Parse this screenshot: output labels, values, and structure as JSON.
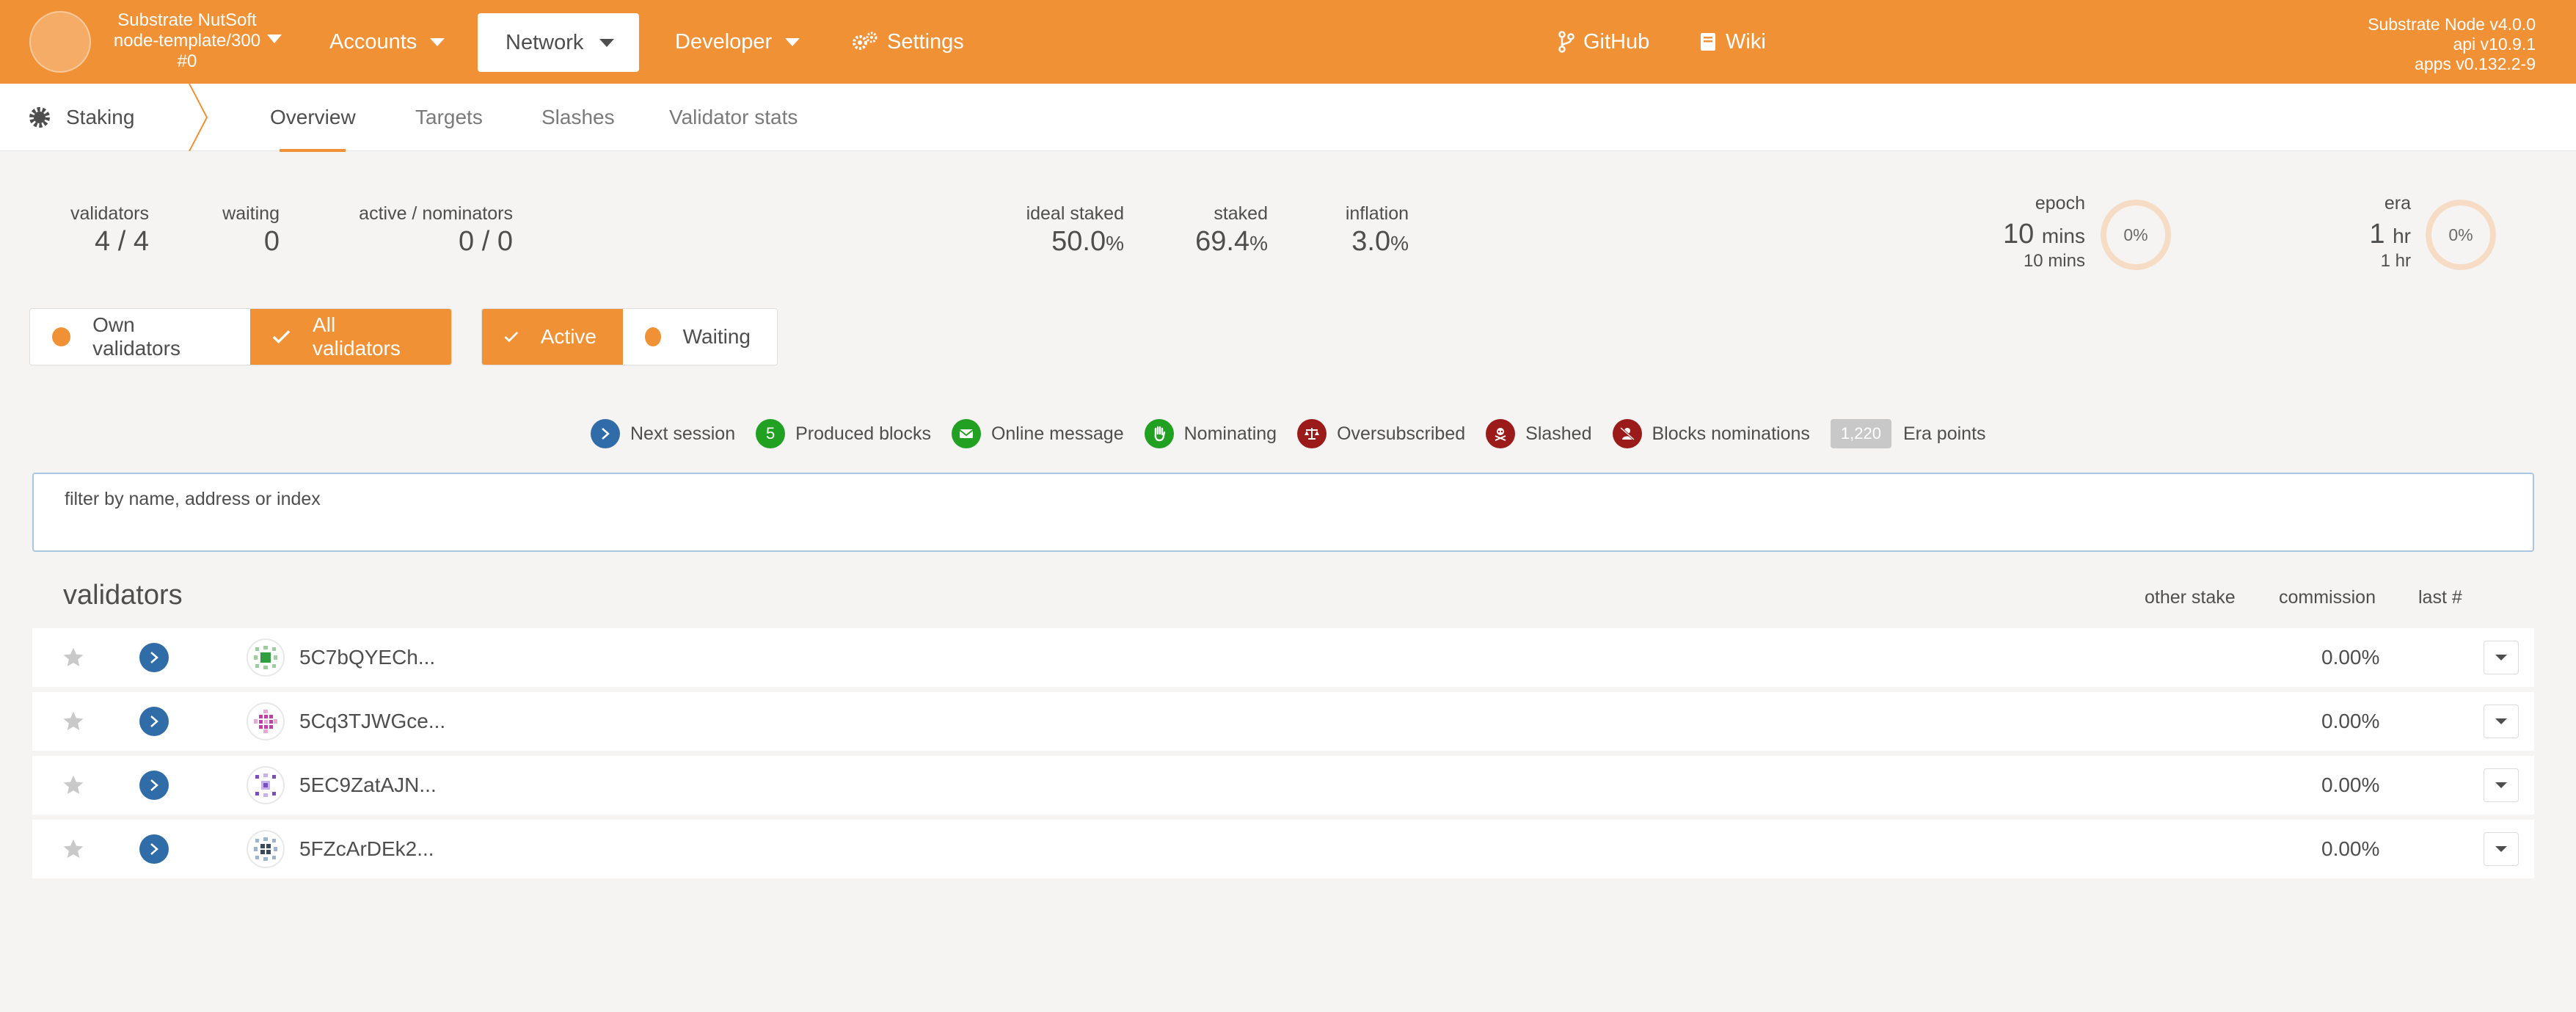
{
  "header": {
    "chain_name": "Substrate NutSoft",
    "chain_spec": "node-template/300",
    "block_number": "#0",
    "nav": {
      "accounts": "Accounts",
      "network": "Network",
      "developer": "Developer",
      "settings": "Settings",
      "github": "GitHub",
      "wiki": "Wiki"
    },
    "node_version": "Substrate Node v4.0.0",
    "api_version": "api v10.9.1",
    "apps_version": "apps v0.132.2-9"
  },
  "subnav": {
    "section": "Staking",
    "tabs": [
      "Overview",
      "Targets",
      "Slashes",
      "Validator stats"
    ],
    "active_tab": "Overview"
  },
  "summary": {
    "validators_label": "validators",
    "validators_value": "4 / 4",
    "waiting_label": "waiting",
    "waiting_value": "0",
    "active_nominators_label": "active / nominators",
    "active_nominators_value": "0 / 0",
    "ideal_staked_label": "ideal staked",
    "ideal_staked_value": "50.0",
    "staked_label": "staked",
    "staked_value": "69.4",
    "inflation_label": "inflation",
    "inflation_value": "3.0",
    "percent_unit": "%",
    "epoch_label": "epoch",
    "epoch_value": "10",
    "epoch_unit": "mins",
    "epoch_total": "10 mins",
    "epoch_progress": "0%",
    "era_label": "era",
    "era_value": "1",
    "era_unit": "hr",
    "era_total": "1 hr",
    "era_progress": "0%"
  },
  "filters": {
    "own_validators": "Own validators",
    "all_validators": "All validators",
    "active": "Active",
    "waiting": "Waiting"
  },
  "legend": {
    "next_session": "Next session",
    "produced_blocks_count": "5",
    "produced_blocks": "Produced blocks",
    "online_message": "Online message",
    "nominating": "Nominating",
    "oversubscribed": "Oversubscribed",
    "slashed": "Slashed",
    "blocks_nominations": "Blocks nominations",
    "era_points_value": "1,220",
    "era_points": "Era points"
  },
  "search": {
    "label": "filter by name, address or index",
    "value": ""
  },
  "table": {
    "title": "validators",
    "col_other_stake": "other stake",
    "col_commission": "commission",
    "col_last": "last #",
    "rows": [
      {
        "address": "5C7bQYECh...",
        "commission": "0.00%",
        "icon_color": "#2e9e3e"
      },
      {
        "address": "5Cq3TJWGce...",
        "commission": "0.00%",
        "icon_color": "#c23fa8"
      },
      {
        "address": "5EC9ZatAJN...",
        "commission": "0.00%",
        "icon_color": "#7b4fc4"
      },
      {
        "address": "5FZcArDEk2...",
        "commission": "0.00%",
        "icon_color": "#3a4a5a"
      }
    ]
  },
  "colors": {
    "accent": "#f19135",
    "badge_blue": "#2f6ca8",
    "badge_green": "#21a021",
    "badge_red": "#9b1a1a"
  }
}
